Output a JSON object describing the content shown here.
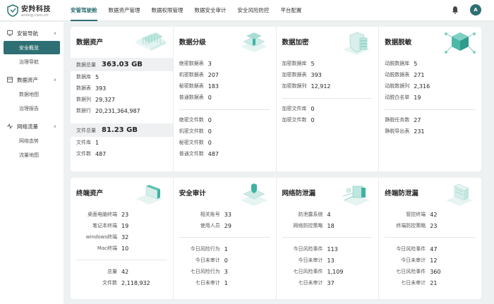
{
  "logo": {
    "name": "安羚科技",
    "sub": "anling.com.cn"
  },
  "nav": [
    "安管驾驶舱",
    "数据资产管理",
    "数据权限管理",
    "数据安全审计",
    "安全风险防控",
    "平台配置"
  ],
  "user": {
    "avatar": "A"
  },
  "sidebar": {
    "groups": [
      {
        "label": "安管导航",
        "items": [
          "安全概览",
          "治理导航"
        ]
      },
      {
        "label": "数据资产",
        "items": [
          "数据地图",
          "治理报告"
        ]
      },
      {
        "label": "网络流量",
        "items": [
          "网络态势",
          "流量地图"
        ]
      }
    ]
  },
  "top": {
    "asset": {
      "title": "数据资产",
      "db_total_label": "数据总量",
      "db_total_value": "363.03 GB",
      "db_rows": [
        [
          "数据库",
          "5"
        ],
        [
          "数据表",
          "393"
        ],
        [
          "数据列",
          "29,327"
        ],
        [
          "数据行",
          "20,231,364,987"
        ]
      ],
      "file_total_label": "文件总量",
      "file_total_value": "81.23 GB",
      "file_rows": [
        [
          "文件库",
          "1"
        ],
        [
          "文件数",
          "487"
        ]
      ]
    },
    "classify": {
      "title": "数据分级",
      "rows_a": [
        [
          "绝密数据表",
          "3"
        ],
        [
          "机密数据表",
          "207"
        ],
        [
          "秘密数据表",
          "183"
        ],
        [
          "普通数据表",
          "0"
        ]
      ],
      "rows_b": [
        [
          "绝密文件数",
          "0"
        ],
        [
          "机密文件数",
          "0"
        ],
        [
          "秘密文件数",
          "0"
        ],
        [
          "普通文件数",
          "487"
        ]
      ]
    },
    "encrypt": {
      "title": "数据加密",
      "rows_a": [
        [
          "加密数据库",
          "5"
        ],
        [
          "加密数据表",
          "393"
        ],
        [
          "加密数据列",
          "12,912"
        ]
      ],
      "rows_b": [
        [
          "加密文件库",
          "0"
        ],
        [
          "加密文件数",
          "0"
        ]
      ]
    },
    "mask": {
      "title": "数据脱敏",
      "rows_a": [
        [
          "动脱数据库",
          "5"
        ],
        [
          "动脱数据表",
          "271"
        ],
        [
          "动脱数据列",
          "2,316"
        ],
        [
          "动脱白名单",
          "19"
        ]
      ],
      "rows_b": [
        [
          "静脱任务数",
          "27"
        ],
        [
          "静脱导出表",
          "231"
        ]
      ]
    }
  },
  "bottom": {
    "terminal": {
      "title": "终端资产",
      "rows_a": [
        [
          "桌面电脑终端",
          "23"
        ],
        [
          "笔记本终端",
          "19"
        ],
        [
          "windows终端",
          "32"
        ],
        [
          "Mac终端",
          "10"
        ]
      ],
      "rows_b": [
        [
          "总量",
          "42"
        ],
        [
          "文件数",
          "2,118,932"
        ]
      ]
    },
    "audit": {
      "title": "安全审计",
      "rows_a": [
        [
          "相关账号",
          "33"
        ],
        [
          "使用人员",
          "29"
        ]
      ],
      "rows_b": [
        [
          "今日风险行为",
          "1"
        ],
        [
          "今日未审计",
          "0"
        ],
        [
          "七日风险行为",
          "3"
        ],
        [
          "七日未审计",
          "1"
        ]
      ]
    },
    "netleak": {
      "title": "网络防泄漏",
      "rows_a": [
        [
          "防泄露系统",
          "4"
        ],
        [
          "网络防控策略",
          "18"
        ]
      ],
      "rows_b": [
        [
          "今日风险事件",
          "113"
        ],
        [
          "今日未审计",
          "13"
        ],
        [
          "七日风险事件",
          "1,109"
        ],
        [
          "七日未审计",
          "37"
        ]
      ]
    },
    "termleak": {
      "title": "终端防泄漏",
      "rows_a": [
        [
          "管控终端",
          "42"
        ],
        [
          "终端防控策略",
          "23"
        ]
      ],
      "rows_b": [
        [
          "今日风险事件",
          "47"
        ],
        [
          "今日未审计",
          "12"
        ],
        [
          "七日风险事件",
          "360"
        ],
        [
          "七日未审计",
          "21"
        ]
      ]
    }
  }
}
